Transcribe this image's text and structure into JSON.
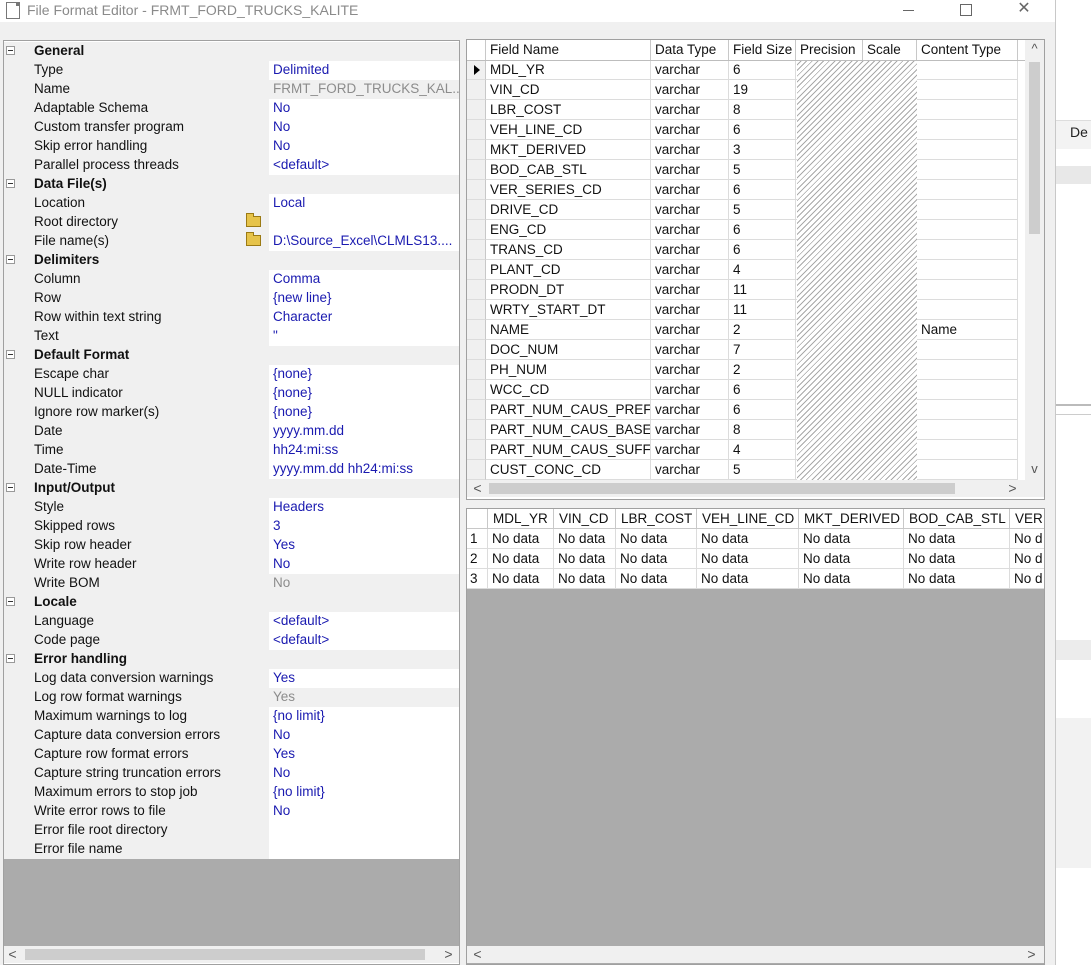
{
  "window": {
    "title": "File Format Editor - FRMT_FORD_TRUCKS_KALITE",
    "close_glyph": "✕"
  },
  "properties": [
    {
      "type": "category",
      "label": "General"
    },
    {
      "type": "prop",
      "label": "Type",
      "value": "Delimited"
    },
    {
      "type": "prop",
      "label": "Name",
      "value": "FRMT_FORD_TRUCKS_KAL...",
      "gray": true
    },
    {
      "type": "prop",
      "label": "Adaptable Schema",
      "value": "No"
    },
    {
      "type": "prop",
      "label": "Custom transfer program",
      "value": "No"
    },
    {
      "type": "prop",
      "label": "Skip error handling",
      "value": "No"
    },
    {
      "type": "prop",
      "label": "Parallel process threads",
      "value": "<default>"
    },
    {
      "type": "category",
      "label": "Data File(s)"
    },
    {
      "type": "prop",
      "label": "Location",
      "value": "Local"
    },
    {
      "type": "prop",
      "label": "Root directory",
      "value": "",
      "folder": true
    },
    {
      "type": "prop",
      "label": "File name(s)",
      "value": "D:\\Source_Excel\\CLMLS13....",
      "folder": true
    },
    {
      "type": "category",
      "label": "Delimiters"
    },
    {
      "type": "prop",
      "label": "Column",
      "value": "Comma"
    },
    {
      "type": "prop",
      "label": "Row",
      "value": "{new line}"
    },
    {
      "type": "prop",
      "label": "Row within text string",
      "value": "Character"
    },
    {
      "type": "prop",
      "label": "Text",
      "value": "\""
    },
    {
      "type": "category",
      "label": "Default Format"
    },
    {
      "type": "prop",
      "label": "Escape char",
      "value": "{none}"
    },
    {
      "type": "prop",
      "label": "NULL indicator",
      "value": "{none}"
    },
    {
      "type": "prop",
      "label": "Ignore row marker(s)",
      "value": "{none}"
    },
    {
      "type": "prop",
      "label": "Date",
      "value": "yyyy.mm.dd"
    },
    {
      "type": "prop",
      "label": "Time",
      "value": "hh24:mi:ss"
    },
    {
      "type": "prop",
      "label": "Date-Time",
      "value": "yyyy.mm.dd hh24:mi:ss"
    },
    {
      "type": "category",
      "label": "Input/Output"
    },
    {
      "type": "prop",
      "label": "Style",
      "value": "Headers"
    },
    {
      "type": "prop",
      "label": "Skipped rows",
      "value": "3"
    },
    {
      "type": "prop",
      "label": "Skip row header",
      "value": "Yes"
    },
    {
      "type": "prop",
      "label": "Write row header",
      "value": "No"
    },
    {
      "type": "prop",
      "label": "Write BOM",
      "value": "No",
      "gray": true
    },
    {
      "type": "category",
      "label": "Locale"
    },
    {
      "type": "prop",
      "label": "Language",
      "value": "<default>"
    },
    {
      "type": "prop",
      "label": "Code page",
      "value": "<default>"
    },
    {
      "type": "category",
      "label": "Error handling"
    },
    {
      "type": "prop",
      "label": "Log data conversion warnings",
      "value": "Yes"
    },
    {
      "type": "prop",
      "label": "Log row format warnings",
      "value": "Yes",
      "gray": true
    },
    {
      "type": "prop",
      "label": "Maximum warnings to log",
      "value": "{no limit}"
    },
    {
      "type": "prop",
      "label": "Capture data conversion errors",
      "value": "No"
    },
    {
      "type": "prop",
      "label": "Capture row format errors",
      "value": "Yes"
    },
    {
      "type": "prop",
      "label": "Capture string truncation errors",
      "value": "No"
    },
    {
      "type": "prop",
      "label": "Maximum errors to stop job",
      "value": "{no limit}"
    },
    {
      "type": "prop",
      "label": "Write error rows to file",
      "value": "No"
    },
    {
      "type": "prop",
      "label": "Error file root directory",
      "value": ""
    },
    {
      "type": "prop",
      "label": "Error file name",
      "value": ""
    }
  ],
  "field_grid": {
    "columns": [
      "Field Name",
      "Data Type",
      "Field Size",
      "Precision",
      "Scale",
      "Content Type"
    ],
    "rows": [
      {
        "name": "MDL_YR",
        "type": "varchar",
        "size": "6",
        "content": ""
      },
      {
        "name": "VIN_CD",
        "type": "varchar",
        "size": "19",
        "content": ""
      },
      {
        "name": "LBR_COST",
        "type": "varchar",
        "size": "8",
        "content": ""
      },
      {
        "name": "VEH_LINE_CD",
        "type": "varchar",
        "size": "6",
        "content": ""
      },
      {
        "name": "MKT_DERIVED",
        "type": "varchar",
        "size": "3",
        "content": ""
      },
      {
        "name": "BOD_CAB_STL",
        "type": "varchar",
        "size": "5",
        "content": ""
      },
      {
        "name": "VER_SERIES_CD",
        "type": "varchar",
        "size": "6",
        "content": ""
      },
      {
        "name": "DRIVE_CD",
        "type": "varchar",
        "size": "5",
        "content": ""
      },
      {
        "name": "ENG_CD",
        "type": "varchar",
        "size": "6",
        "content": ""
      },
      {
        "name": "TRANS_CD",
        "type": "varchar",
        "size": "6",
        "content": ""
      },
      {
        "name": "PLANT_CD",
        "type": "varchar",
        "size": "4",
        "content": ""
      },
      {
        "name": "PRODN_DT",
        "type": "varchar",
        "size": "11",
        "content": ""
      },
      {
        "name": "WRTY_START_DT",
        "type": "varchar",
        "size": "11",
        "content": ""
      },
      {
        "name": "NAME",
        "type": "varchar",
        "size": "2",
        "content": "Name"
      },
      {
        "name": "DOC_NUM",
        "type": "varchar",
        "size": "7",
        "content": ""
      },
      {
        "name": "PH_NUM",
        "type": "varchar",
        "size": "2",
        "content": ""
      },
      {
        "name": "WCC_CD",
        "type": "varchar",
        "size": "6",
        "content": ""
      },
      {
        "name": "PART_NUM_CAUS_PREF",
        "type": "varchar",
        "size": "6",
        "content": ""
      },
      {
        "name": "PART_NUM_CAUS_BASE",
        "type": "varchar",
        "size": "8",
        "content": ""
      },
      {
        "name": "PART_NUM_CAUS_SUFF",
        "type": "varchar",
        "size": "4",
        "content": ""
      },
      {
        "name": "CUST_CONC_CD",
        "type": "varchar",
        "size": "5",
        "content": ""
      }
    ]
  },
  "preview_grid": {
    "columns": [
      "MDL_YR",
      "VIN_CD",
      "LBR_COST",
      "VEH_LINE_CD",
      "MKT_DERIVED",
      "BOD_CAB_STL",
      "VER"
    ],
    "rows": [
      {
        "num": "1",
        "cells": [
          "No data",
          "No data",
          "No data",
          "No data",
          "No data",
          "No data",
          "No d"
        ]
      },
      {
        "num": "2",
        "cells": [
          "No data",
          "No data",
          "No data",
          "No data",
          "No data",
          "No data",
          "No d"
        ]
      },
      {
        "num": "3",
        "cells": [
          "No data",
          "No data",
          "No data",
          "No data",
          "No data",
          "No data",
          "No d"
        ]
      }
    ]
  },
  "scroll_arrows": {
    "left": "<",
    "right": ">",
    "up": "^",
    "down": "v"
  },
  "background_app": {
    "fragment_text": "De"
  }
}
